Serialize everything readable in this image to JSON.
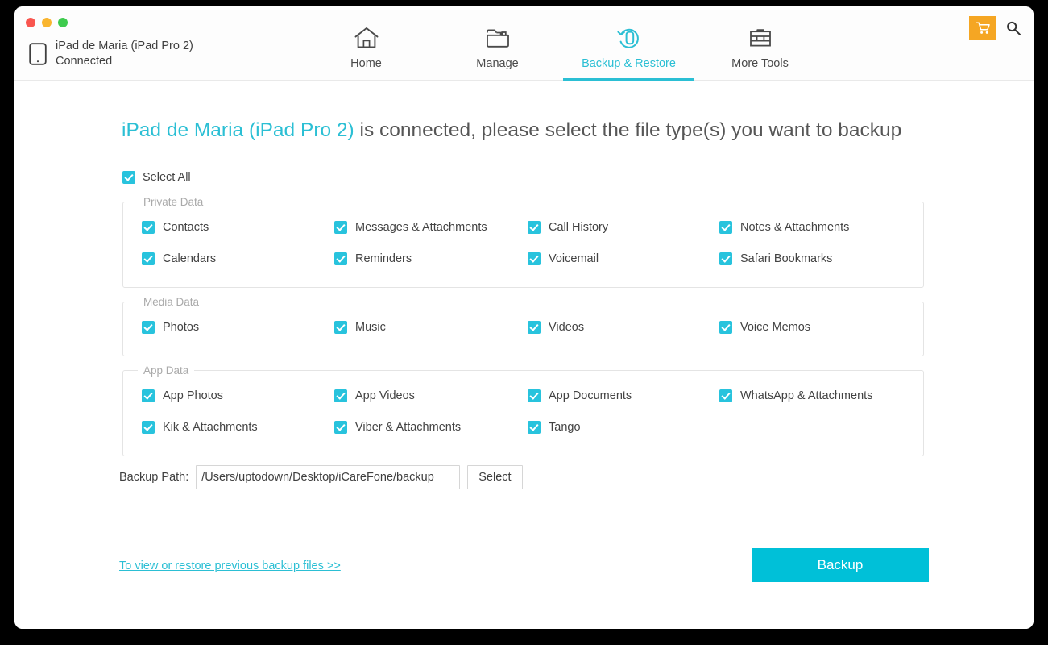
{
  "window": {
    "traffic_lights": [
      "close",
      "minimize",
      "maximize"
    ]
  },
  "device": {
    "icon": "ipad-icon",
    "name": "iPad de Maria (iPad Pro 2)",
    "status": "Connected"
  },
  "nav": {
    "tabs": [
      {
        "label": "Home",
        "icon": "home-icon",
        "active": false
      },
      {
        "label": "Manage",
        "icon": "folder-icon",
        "active": false
      },
      {
        "label": "Backup & Restore",
        "icon": "backup-restore-icon",
        "active": true
      },
      {
        "label": "More Tools",
        "icon": "toolbox-icon",
        "active": false
      }
    ]
  },
  "top_right": {
    "cart_icon": "shopping-cart-icon",
    "search_icon": "search-icon"
  },
  "main": {
    "headline_device": "iPad de Maria (iPad Pro 2)",
    "headline_rest": " is connected, please select the file type(s) you want to backup",
    "select_all_label": "Select All",
    "groups": [
      {
        "legend": "Private Data",
        "rows": [
          [
            {
              "label": "Contacts",
              "checked": true
            },
            {
              "label": "Messages & Attachments",
              "checked": true
            },
            {
              "label": "Call History",
              "checked": true
            },
            {
              "label": "Notes & Attachments",
              "checked": true
            }
          ],
          [
            {
              "label": "Calendars",
              "checked": true
            },
            {
              "label": "Reminders",
              "checked": true
            },
            {
              "label": "Voicemail",
              "checked": true
            },
            {
              "label": "Safari Bookmarks",
              "checked": true
            }
          ]
        ]
      },
      {
        "legend": "Media Data",
        "rows": [
          [
            {
              "label": "Photos",
              "checked": true
            },
            {
              "label": "Music",
              "checked": true
            },
            {
              "label": "Videos",
              "checked": true
            },
            {
              "label": "Voice Memos",
              "checked": true
            }
          ]
        ]
      },
      {
        "legend": "App Data",
        "rows": [
          [
            {
              "label": "App Photos",
              "checked": true
            },
            {
              "label": "App Videos",
              "checked": true
            },
            {
              "label": "App Documents",
              "checked": true
            },
            {
              "label": "WhatsApp & Attachments",
              "checked": true
            }
          ],
          [
            {
              "label": "Kik & Attachments",
              "checked": true
            },
            {
              "label": "Viber & Attachments",
              "checked": true
            },
            {
              "label": "Tango",
              "checked": true
            }
          ]
        ]
      }
    ],
    "backup_path": {
      "label": "Backup Path:",
      "value": "/Users/uptodown/Desktop/iCareFone/backup",
      "select_button": "Select"
    },
    "restore_link": "To view or restore previous backup files >>",
    "backup_button": "Backup"
  },
  "colors": {
    "accent": "#2bbfd4",
    "checkbox": "#28c3dd",
    "button": "#00c0d8",
    "cart": "#f5a623"
  }
}
